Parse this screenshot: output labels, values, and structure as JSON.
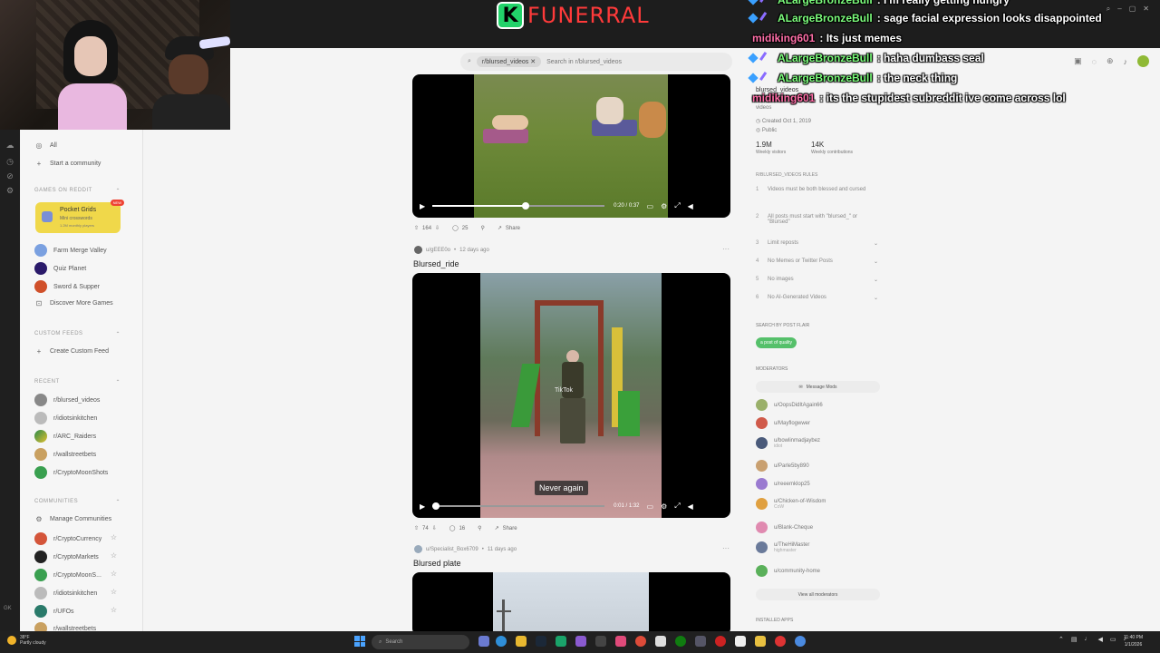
{
  "stream": {
    "logo_letter": "K",
    "logo_text": "FUNERRAL"
  },
  "search": {
    "chip": "r/blursed_videos",
    "placeholder": "Search in r/blursed_videos"
  },
  "chat": [
    {
      "user": "ALargeBronzeBull",
      "text": ": I'm really getting hungry",
      "color": "#7cfc7c",
      "badges": true
    },
    {
      "user": "ALargeBronzeBull",
      "text": ": sage facial expression looks disappointed",
      "color": "#7cfc7c",
      "badges": true
    },
    {
      "user": "midiking601",
      "text": ": Its just memes",
      "color": "#ff6fa8",
      "badges": false
    },
    {
      "user": "ALargeBronzeBull",
      "text": ": haha dumbass seal",
      "color": "#7cfc7c",
      "badges": true
    },
    {
      "user": "ALargeBronzeBull",
      "text": ": the neck thing",
      "color": "#7cfc7c",
      "badges": true
    },
    {
      "user": "midiking601",
      "text": ": its the stupidest subreddit ive come across lol",
      "color": "#ff6fa8",
      "badges": false
    }
  ],
  "sidebar": {
    "all": "All",
    "start_community": "Start a community",
    "games_section": "GAMES ON REDDIT",
    "game_card": {
      "title": "Pocket Grids",
      "sub": "Mini crosswords",
      "sub2": "1.2M monthly players",
      "badge": "NEW"
    },
    "games": [
      "Farm Merge Valley",
      "Quiz Planet",
      "Sword & Supper",
      "Discover More Games"
    ],
    "custom_section": "CUSTOM FEEDS",
    "create_feed": "Create Custom Feed",
    "recent_section": "RECENT",
    "recent": [
      "r/blursed_videos",
      "r/idiotsinkitchen",
      "r/ARC_Raiders",
      "r/wallstreetbets",
      "r/CryptoMoonShots"
    ],
    "communities_section": "COMMUNITIES",
    "manage": "Manage Communities",
    "communities": [
      "r/CryptoCurrency",
      "r/CryptoMarkets",
      "r/CryptoMoonS...",
      "r/idiotsinkitchen",
      "r/UFOs",
      "r/wallstreetbets"
    ]
  },
  "posts": [
    {
      "time": "0:20 / 0:37",
      "progress": 0.54,
      "upvotes": "164",
      "comments": "25",
      "share": "Share"
    },
    {
      "author": "u/gEEE0o",
      "age": "12 days ago",
      "title": "Blursed_ride",
      "caption": "Never again",
      "time": "0:01 / 1:32",
      "progress": 0.02,
      "upvotes": "74",
      "comments": "16",
      "share": "Share",
      "watermark": "TikTok"
    },
    {
      "author": "u/Specialist_Box6709",
      "age": "11 days ago",
      "title": "Blursed plate"
    }
  ],
  "about": {
    "name": "blursed_videos",
    "desc": "videos",
    "created": "Created Oct 1, 2019",
    "visibility": "Public",
    "visitors": "1.9M",
    "visitors_label": "Weekly visitors",
    "contributions": "14K",
    "contributions_label": "Weekly contributions",
    "rules_title": "R/BLURSED_VIDEOS RULES",
    "rules": [
      {
        "num": "1",
        "text": "Videos must be both blessed and cursed"
      },
      {
        "num": "2",
        "text": "All posts must start with \"blursed_\" or \"Blursed\""
      },
      {
        "num": "3",
        "text": "Limit reposts"
      },
      {
        "num": "4",
        "text": "No Memes or Twitter Posts"
      },
      {
        "num": "5",
        "text": "No images"
      },
      {
        "num": "6",
        "text": "No AI-Generated Videos"
      }
    ],
    "flair_title": "SEARCH BY POST FLAIR",
    "flair": "a post of quality",
    "mods_title": "MODERATORS",
    "message_mods": "Message Mods",
    "mods": [
      {
        "name": "u/OopsDidItAgain66",
        "sub": ""
      },
      {
        "name": "u/Mayflogwwer",
        "sub": ""
      },
      {
        "name": "u/bowlinmadjaybez",
        "sub": "idiot"
      },
      {
        "name": "u/Parle5by890",
        "sub": ""
      },
      {
        "name": "u/reeemklop25",
        "sub": ""
      },
      {
        "name": "u/Chicken-of-Wisdom",
        "sub": "CoW"
      },
      {
        "name": "u/Blank-Cheque",
        "sub": ""
      },
      {
        "name": "u/TheHiMaster",
        "sub": "highmaster"
      },
      {
        "name": "u/community-home",
        "sub": ""
      }
    ],
    "view_all": "View all moderators",
    "installed": "INSTALLED APPS"
  },
  "taskbar": {
    "temp": "38°F",
    "weather": "Partly cloudy",
    "search": "Search",
    "time": "11:40 PM",
    "date": "1/1/2026"
  }
}
